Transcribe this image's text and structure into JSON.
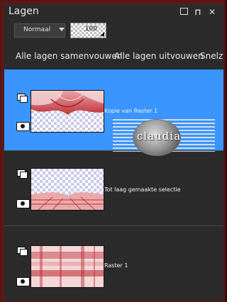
{
  "panel": {
    "title": "Lagen"
  },
  "window_controls": [
    {
      "name": "restore-button",
      "glyph": "□"
    },
    {
      "name": "pin-button",
      "glyph": "⊓"
    },
    {
      "name": "close-button",
      "glyph": "✕"
    }
  ],
  "blend_mode": {
    "value": "Normaal"
  },
  "opacity": {
    "value": "100"
  },
  "toolbar": {
    "merge_all": "Alle lagen samenvouwen",
    "expand_all": "Alle lagen uitvouwen",
    "quick": "Snelz"
  },
  "layers": [
    {
      "name": "Kopie van Raster 1",
      "selected": true,
      "visible": true
    },
    {
      "name": "Tot laag gemaakte selectie",
      "selected": false,
      "visible": true
    },
    {
      "name": "Raster 1",
      "selected": false,
      "visible": true
    }
  ],
  "watermark": {
    "text": "claudia"
  },
  "colors": {
    "selection": "#3a95ff",
    "panel": "#2b2b2b",
    "frame": "#5a1a1a"
  }
}
